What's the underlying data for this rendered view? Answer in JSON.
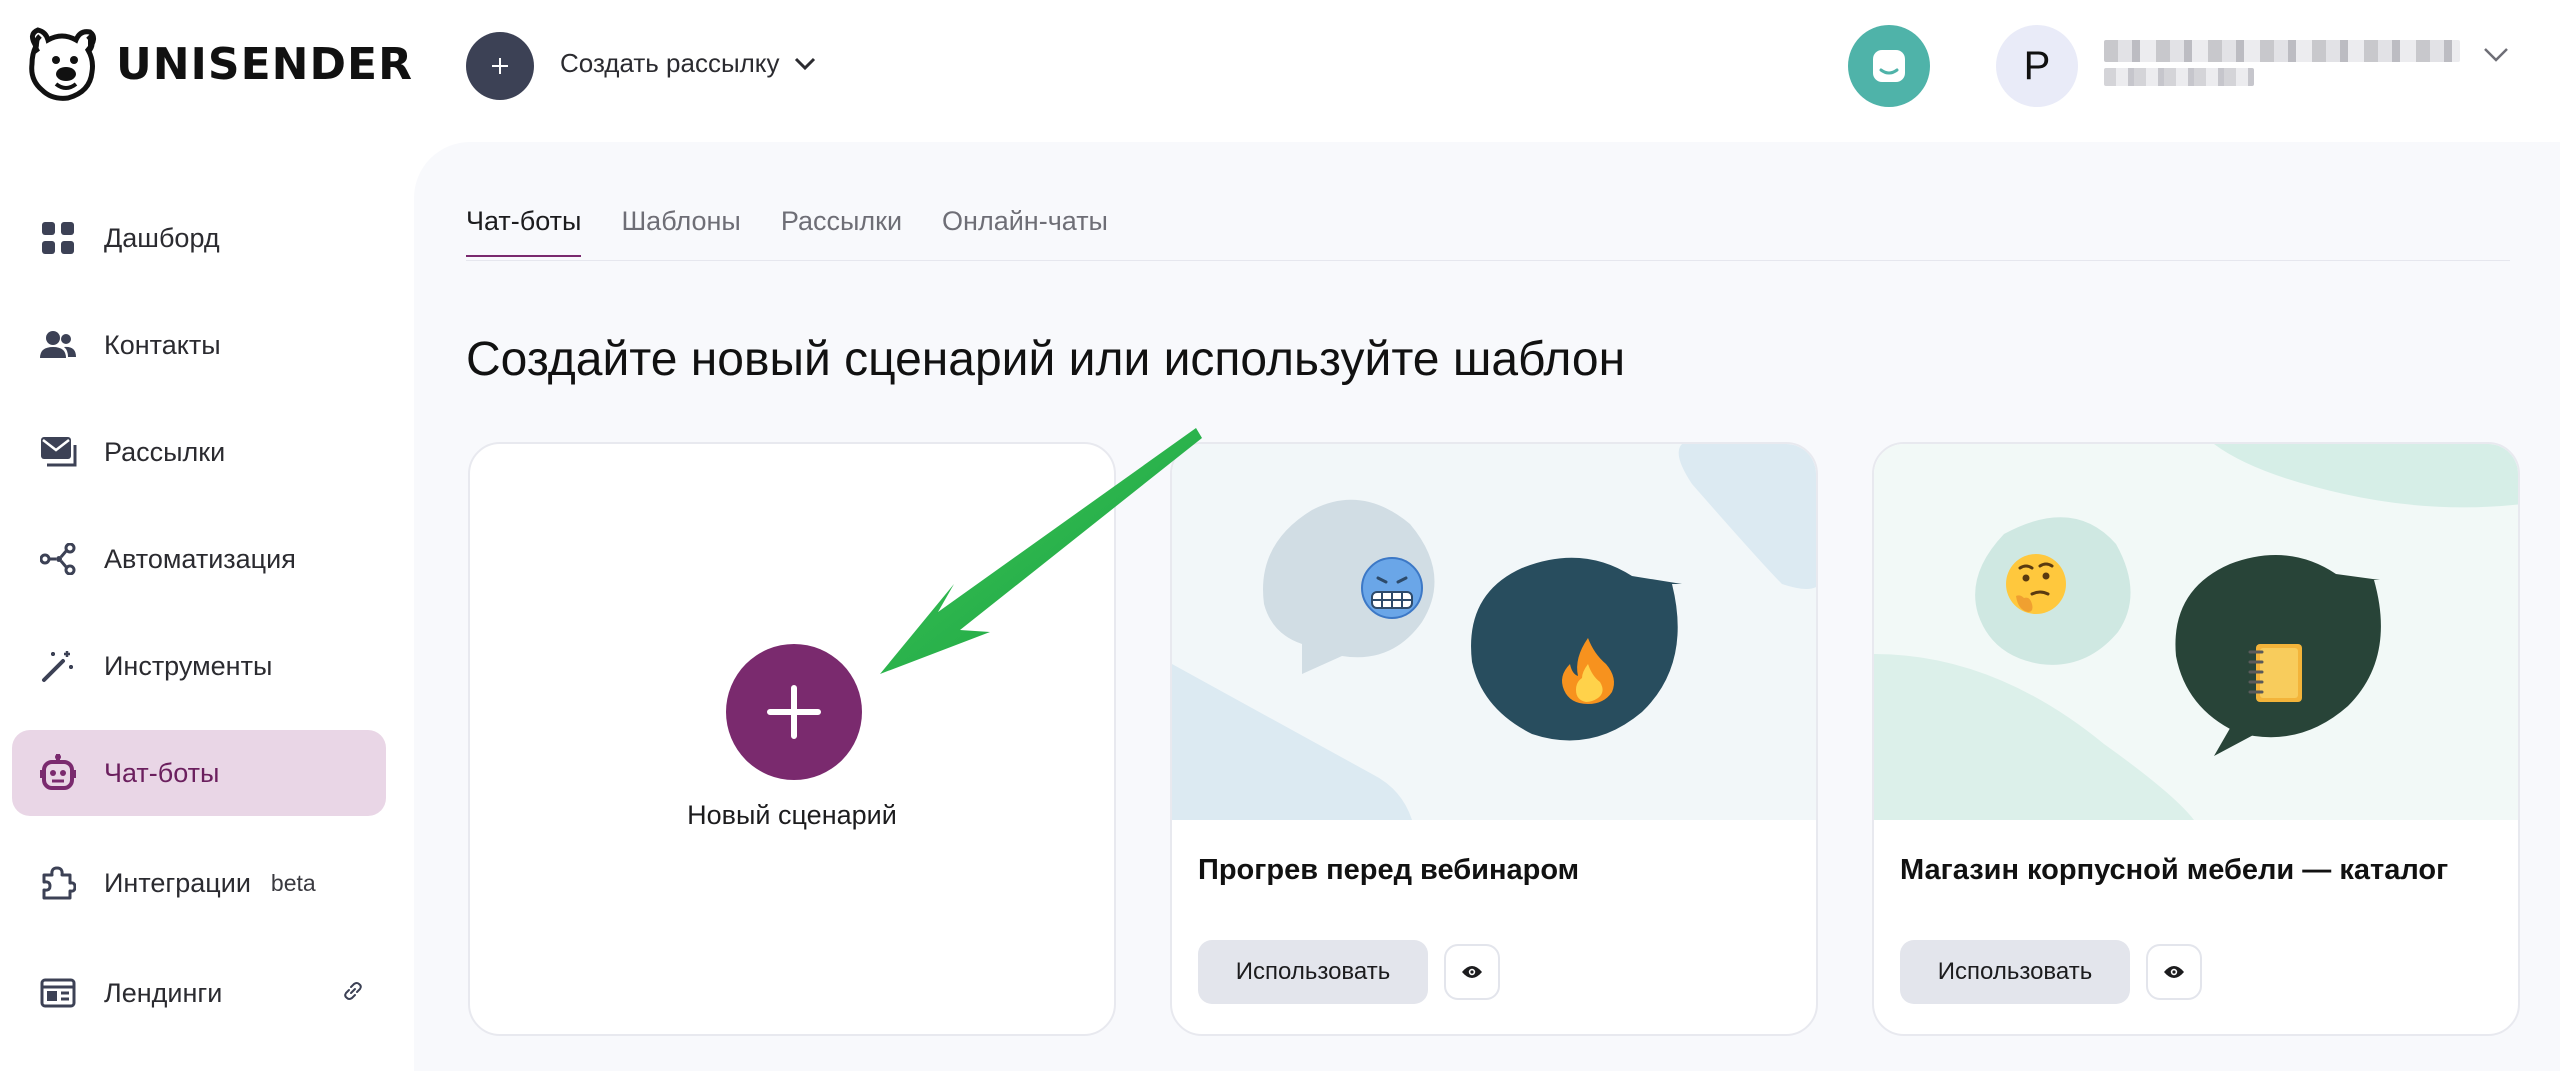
{
  "brand": {
    "name": "UNISENDER"
  },
  "header": {
    "create_label": "Создать рассылку",
    "avatar_letter": "Р"
  },
  "sidebar": {
    "items": [
      {
        "label": "Дашборд",
        "icon": "dashboard-icon"
      },
      {
        "label": "Контакты",
        "icon": "contacts-icon"
      },
      {
        "label": "Рассылки",
        "icon": "mailings-icon"
      },
      {
        "label": "Автоматизация",
        "icon": "automation-icon"
      },
      {
        "label": "Инструменты",
        "icon": "tools-icon"
      },
      {
        "label": "Чат-боты",
        "icon": "chatbot-icon",
        "active": true
      },
      {
        "label": "Интеграции",
        "badge": "beta",
        "icon": "integrations-icon"
      },
      {
        "label": "Лендинги",
        "icon": "landings-icon"
      }
    ]
  },
  "main": {
    "tabs": [
      {
        "label": "Чат-боты",
        "active": true
      },
      {
        "label": "Шаблоны"
      },
      {
        "label": "Рассылки"
      },
      {
        "label": "Онлайн-чаты"
      }
    ],
    "title": "Создайте новый сценарий или используйте шаблон",
    "new_card": {
      "label": "Новый сценарий"
    },
    "templates": [
      {
        "title": "Прогрев перед вебинаром",
        "use_label": "Использовать"
      },
      {
        "title": "Магазин корпусной мебели — каталог",
        "use_label": "Использовать"
      }
    ]
  },
  "colors": {
    "accent": "#7a2a6e",
    "active_bg": "#e9d6e6",
    "support": "#4fb3a9",
    "arrow": "#22b24c"
  }
}
